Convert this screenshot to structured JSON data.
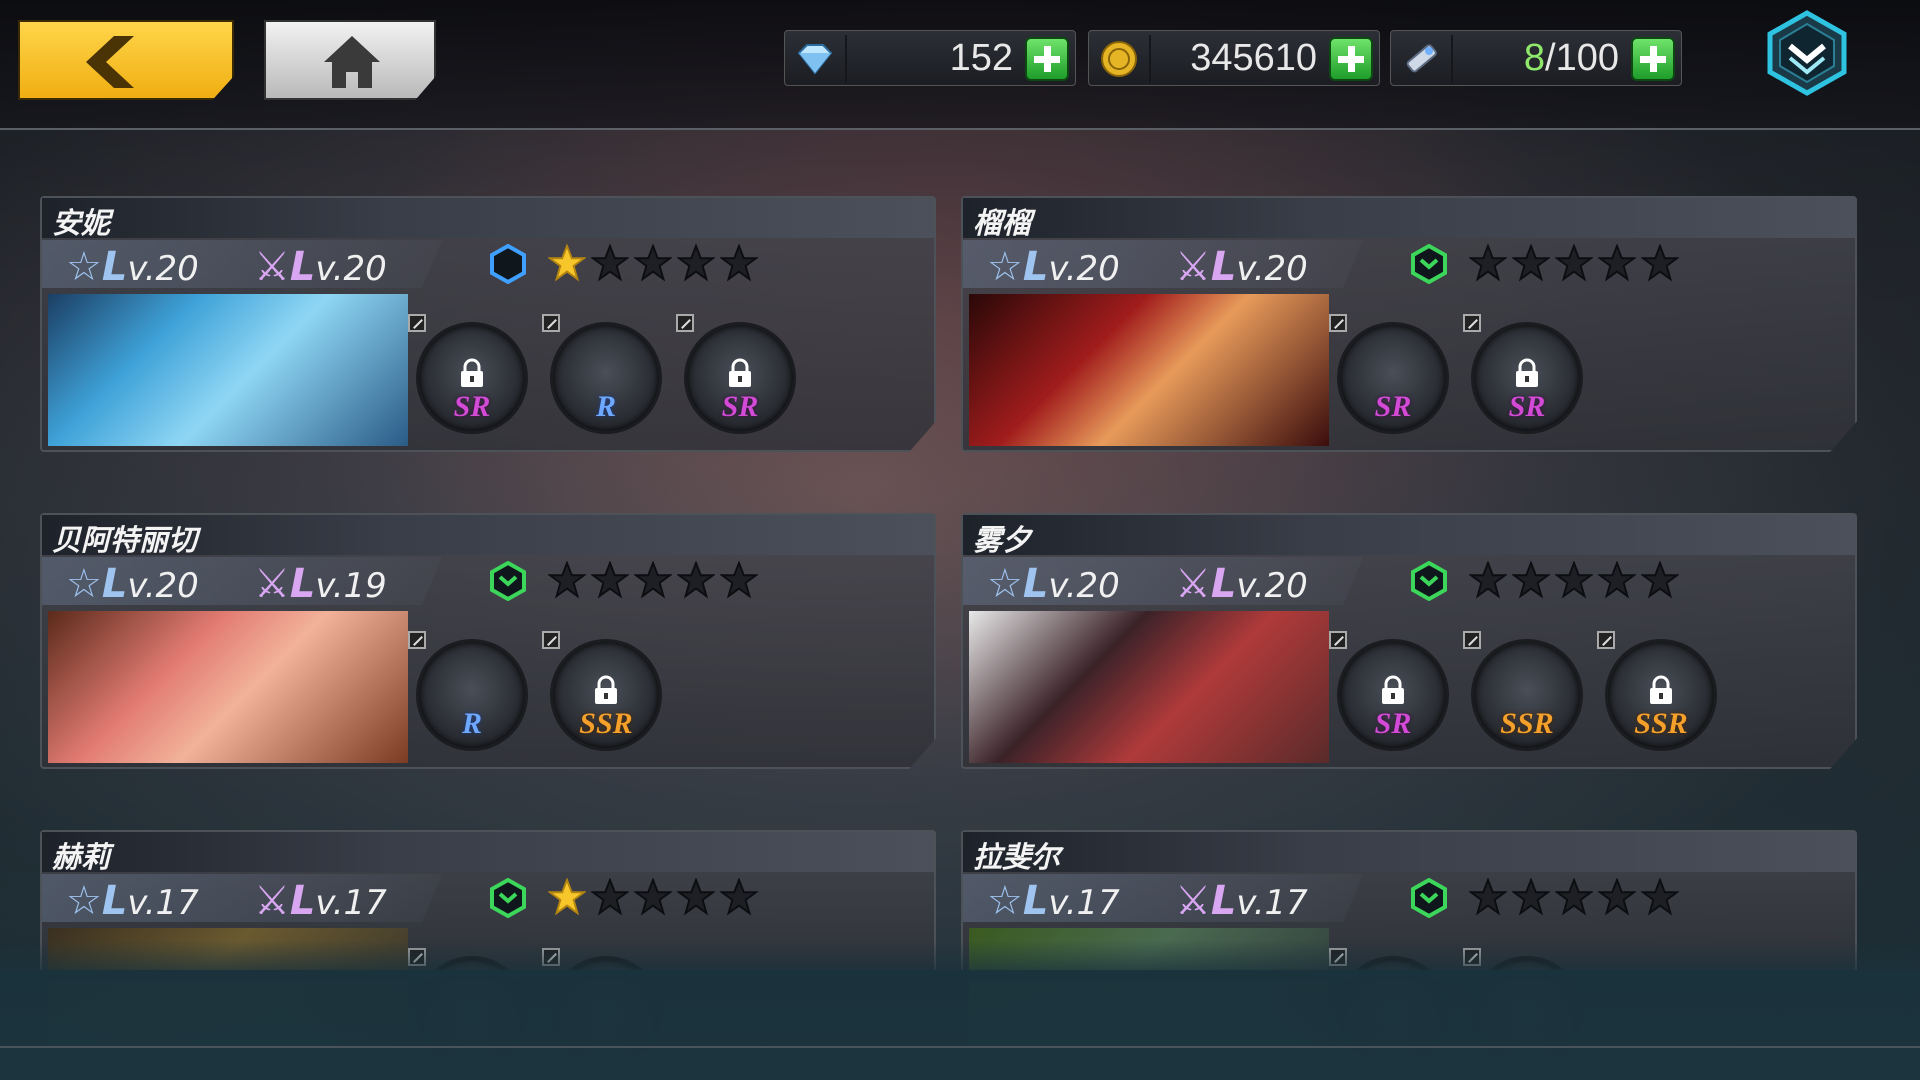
{
  "header": {
    "resources": [
      {
        "icon": "diamond-icon",
        "value": "152"
      },
      {
        "icon": "gold-coin-icon",
        "value": "345610"
      },
      {
        "icon": "stamina-ticket-icon",
        "value_current": "8",
        "value_rest": "/100"
      }
    ],
    "colors": {
      "back_button": "#f0ae12",
      "plus_button": "#2fb53a",
      "menu_accent": "#2ec3e0"
    }
  },
  "characters": [
    {
      "name": "安妮",
      "lv_a": "v.20",
      "lv_b": "v.20",
      "hex_color": "#3fa0ff",
      "stars": 1,
      "weapons": [
        {
          "rarity": "SR",
          "locked": true
        },
        {
          "rarity": "R",
          "locked": false
        },
        {
          "rarity": "SR",
          "locked": true
        }
      ]
    },
    {
      "name": "榴榴",
      "lv_a": "v.20",
      "lv_b": "v.20",
      "hex_color": "#3cd65a",
      "stars": 0,
      "weapons": [
        {
          "rarity": "SR",
          "locked": false
        },
        {
          "rarity": "SR",
          "locked": true
        }
      ]
    },
    {
      "name": "贝阿特丽切",
      "lv_a": "v.20",
      "lv_b": "v.19",
      "hex_color": "#3cd65a",
      "stars": 0,
      "weapons": [
        {
          "rarity": "R",
          "locked": false
        },
        {
          "rarity": "SSR",
          "locked": true
        }
      ]
    },
    {
      "name": "雾夕",
      "lv_a": "v.20",
      "lv_b": "v.20",
      "hex_color": "#3cd65a",
      "stars": 0,
      "weapons": [
        {
          "rarity": "SR",
          "locked": true
        },
        {
          "rarity": "SSR",
          "locked": false
        },
        {
          "rarity": "SSR",
          "locked": true
        }
      ]
    },
    {
      "name": "赫莉",
      "lv_a": "v.17",
      "lv_b": "v.17",
      "hex_color": "#3cd65a",
      "stars": 1,
      "weapons": []
    },
    {
      "name": "拉斐尔",
      "lv_a": "v.17",
      "lv_b": "v.17",
      "hex_color": "#3cd65a",
      "stars": 0,
      "weapons": []
    }
  ]
}
